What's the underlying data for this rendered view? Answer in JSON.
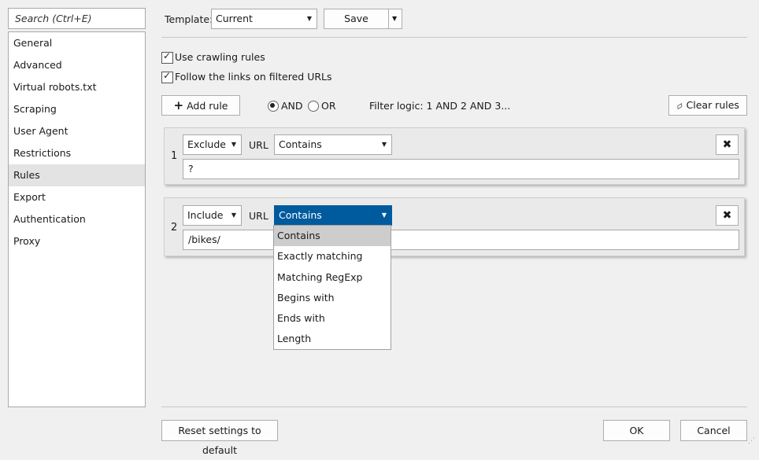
{
  "search": {
    "placeholder": "Search (Ctrl+E)"
  },
  "sidebar": {
    "items": [
      {
        "label": "General"
      },
      {
        "label": "Advanced"
      },
      {
        "label": "Virtual robots.txt"
      },
      {
        "label": "Scraping"
      },
      {
        "label": "User Agent"
      },
      {
        "label": "Restrictions"
      },
      {
        "label": "Rules",
        "selected": true
      },
      {
        "label": "Export"
      },
      {
        "label": "Authentication"
      },
      {
        "label": "Proxy"
      }
    ]
  },
  "template": {
    "label": "Template:",
    "value": "Current",
    "save_label": "Save"
  },
  "options": {
    "use_crawling_rules": {
      "label": "Use crawling rules",
      "checked": true
    },
    "follow_links": {
      "label": "Follow the links on filtered URLs",
      "checked": true
    }
  },
  "toolbar": {
    "add_rule_label": "Add rule",
    "and_label": "AND",
    "or_label": "OR",
    "logic_selected": "AND",
    "filter_logic": "Filter logic: 1 AND 2 AND 3...",
    "clear_rules_label": "Clear rules"
  },
  "rules": [
    {
      "number": "1",
      "action": "Exclude",
      "field_label": "URL",
      "condition": "Contains",
      "value": "?"
    },
    {
      "number": "2",
      "action": "Include",
      "field_label": "URL",
      "condition": "Contains",
      "value": "/bikes/"
    }
  ],
  "condition_dropdown": {
    "options": [
      "Contains",
      "Exactly matching",
      "Matching RegExp",
      "Begins with",
      "Ends with",
      "Length"
    ],
    "highlighted": "Contains"
  },
  "footer": {
    "reset_label": "Reset settings to default",
    "ok_label": "OK",
    "cancel_label": "Cancel"
  },
  "colors": {
    "selected_combo_bg": "#005a9e",
    "selected_nav_bg": "#e3e3e3"
  }
}
